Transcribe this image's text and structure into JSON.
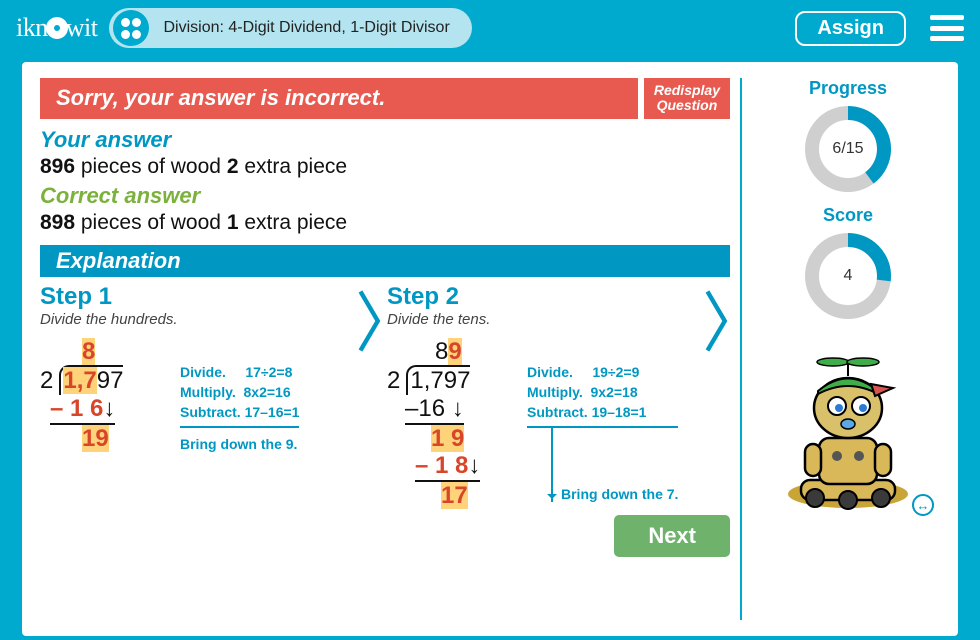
{
  "header": {
    "brand": "iknowit",
    "breadcrumb": "Division: 4-Digit Dividend, 1-Digit Divisor",
    "assign": "Assign"
  },
  "feedback": {
    "banner": "Sorry, your answer is incorrect.",
    "redisplay_l1": "Redisplay",
    "redisplay_l2": "Question",
    "your_label": "Your answer",
    "your_n1": "896",
    "your_t1": " pieces of wood   ",
    "your_n2": "2",
    "your_t2": " extra piece",
    "correct_label": "Correct answer",
    "cor_n1": "898",
    "cor_t1": " pieces of wood   ",
    "cor_n2": "1",
    "cor_t2": " extra piece"
  },
  "expl": {
    "heading": "Explanation",
    "step1": {
      "title": "Step 1",
      "sub": "Divide the hundreds.",
      "q_top": "8",
      "divisor": "2",
      "dividend_hl": "1,7",
      "dividend_rest": "97",
      "row_minus": "– 1 6",
      "row_remain": "19",
      "notes": "Divide.     17÷2=8\nMultiply.  8x2=16\nSubtract. 17–16=1",
      "bring": "Bring down the 9."
    },
    "step2": {
      "title": "Step 2",
      "sub": "Divide the tens.",
      "q_top_a": "8",
      "q_top_b": "9",
      "divisor": "2",
      "dividend": "1,797",
      "row_minus1": "–16",
      "row_mid": "1 9",
      "row_minus2": "– 1 8",
      "row_remain": "17",
      "notes": "Divide.     19÷2=9\nMultiply.  9x2=18\nSubtract. 19–18=1",
      "bring": "Bring down the 7."
    },
    "next": "Next"
  },
  "side": {
    "progress_label": "Progress",
    "progress_value": "6/15",
    "progress_pct": 40,
    "score_label": "Score",
    "score_value": "4",
    "score_pct": 27
  }
}
